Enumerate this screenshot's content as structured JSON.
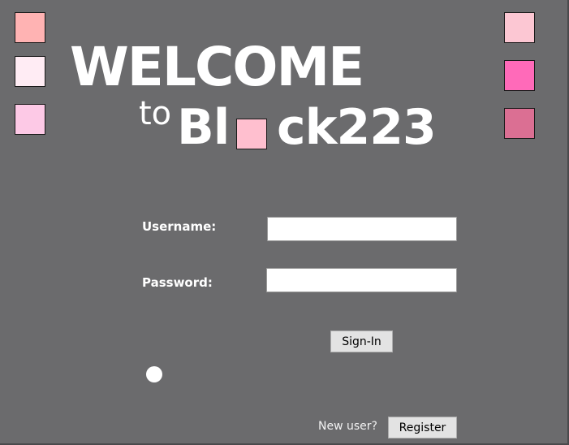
{
  "title": {
    "welcome": "WELCOME",
    "to": "to",
    "name_before": "Bl",
    "name_after": "ck223"
  },
  "login": {
    "username_label": "Username:",
    "password_label": "Password:",
    "username_value": "",
    "password_value": "",
    "signin_label": "Sign-In"
  },
  "footer": {
    "new_user_text": "New user?",
    "register_label": "Register"
  },
  "colors": {
    "background": "#6b6b6d",
    "left_squares": [
      "#ffb3b3",
      "#ffecf4",
      "#fdc9e6"
    ],
    "right_squares": [
      "#fcc7d3",
      "#ff6ab9",
      "#db6f93"
    ],
    "logo_square": "#ffbfcf"
  }
}
